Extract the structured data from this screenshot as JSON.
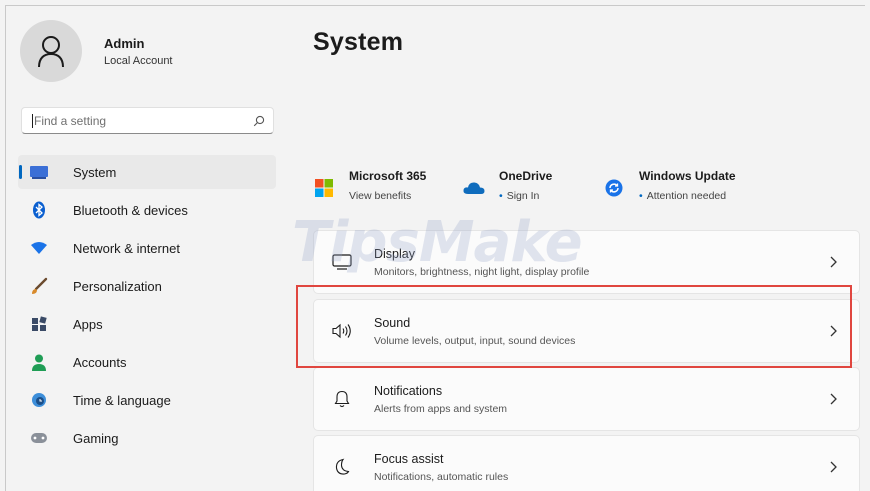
{
  "profile": {
    "name": "Admin",
    "account_type": "Local Account"
  },
  "search": {
    "placeholder": "Find a setting"
  },
  "nav": [
    {
      "label": "System",
      "icon": "monitor-icon",
      "active": true
    },
    {
      "label": "Bluetooth & devices",
      "icon": "bluetooth-icon"
    },
    {
      "label": "Network & internet",
      "icon": "wifi-icon"
    },
    {
      "label": "Personalization",
      "icon": "brush-icon"
    },
    {
      "label": "Apps",
      "icon": "apps-icon"
    },
    {
      "label": "Accounts",
      "icon": "person-icon"
    },
    {
      "label": "Time & language",
      "icon": "globe-clock-icon"
    },
    {
      "label": "Gaming",
      "icon": "gamepad-icon"
    }
  ],
  "main": {
    "title": "System",
    "quick": [
      {
        "title": "Microsoft 365",
        "subtitle": "View benefits",
        "icon": "microsoft-logo-icon"
      },
      {
        "title": "OneDrive",
        "subtitle": "Sign In",
        "icon": "cloud-icon"
      },
      {
        "title": "Windows Update",
        "subtitle": "Attention needed",
        "icon": "sync-icon"
      }
    ],
    "cards": [
      {
        "title": "Display",
        "subtitle": "Monitors, brightness, night light, display profile",
        "icon": "display-icon"
      },
      {
        "title": "Sound",
        "subtitle": "Volume levels, output, input, sound devices",
        "icon": "speaker-icon"
      },
      {
        "title": "Notifications",
        "subtitle": "Alerts from apps and system",
        "icon": "bell-icon"
      },
      {
        "title": "Focus assist",
        "subtitle": "Notifications, automatic rules",
        "icon": "moon-icon"
      }
    ]
  },
  "watermark": "TipsMake",
  "colors": {
    "accent": "#0067c0",
    "highlight": "#e0463f",
    "background": "#f3f3f3",
    "card": "#fbfbfb"
  }
}
